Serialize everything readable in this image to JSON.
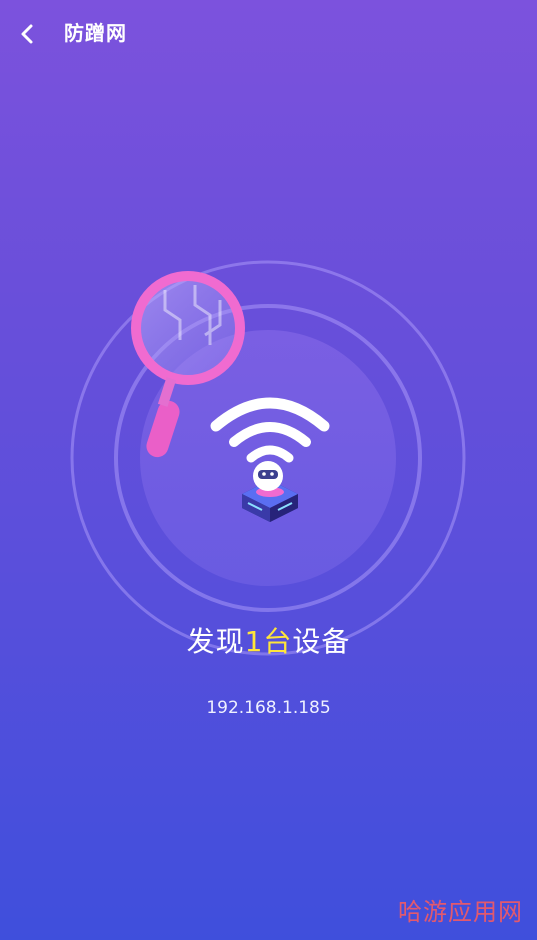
{
  "header": {
    "title": "防蹭网",
    "back_icon": "chevron-left-icon"
  },
  "scan": {
    "magnifier_icon": "magnifier-icon",
    "wifi_icon": "wifi-icon",
    "device_icon": "robot-device-icon"
  },
  "result": {
    "prefix": "发现",
    "count": "1台",
    "suffix": "设备",
    "ip": "192.168.1.185"
  },
  "watermark": {
    "text": "哈游应用网"
  },
  "colors": {
    "gradient_top": "#7c52dd",
    "gradient_bottom": "#3f4fdc",
    "highlight": "#ffe53a",
    "magnifier": "#f06bd0",
    "watermark": "#ff5b5b"
  }
}
